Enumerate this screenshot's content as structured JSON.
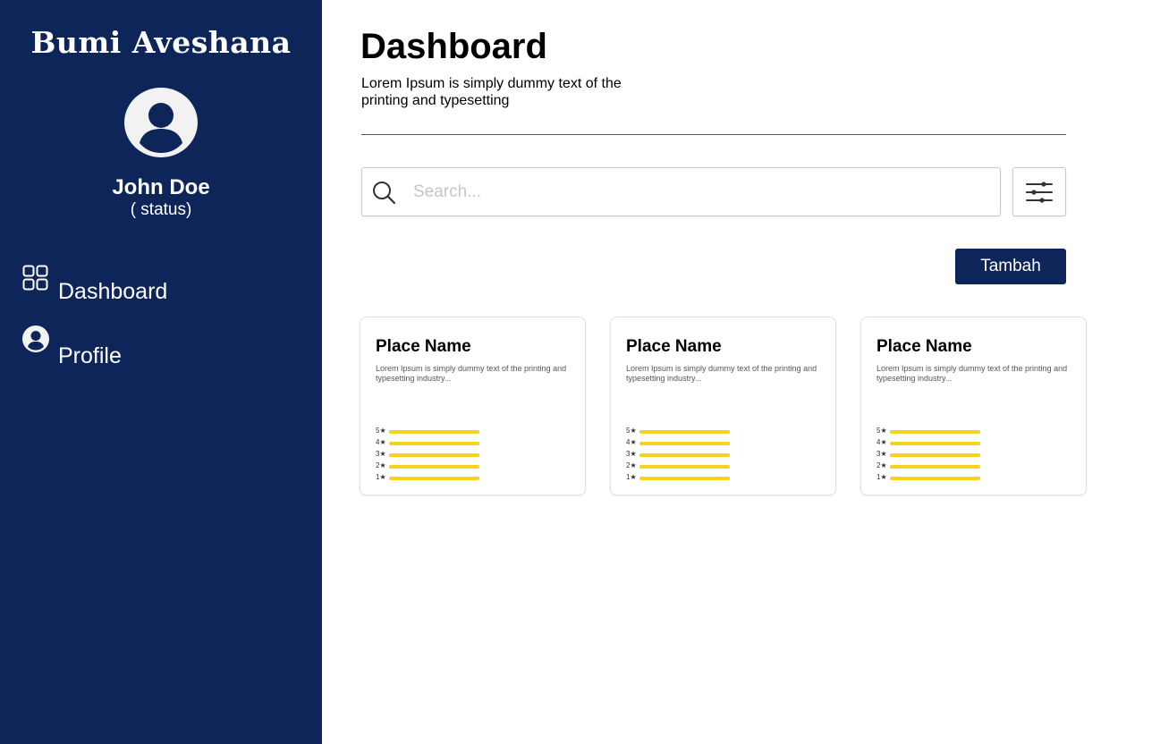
{
  "sidebar": {
    "brand": "Bumi Aveshana",
    "user": {
      "name": "John Doe",
      "status": "( status)"
    },
    "nav": [
      {
        "label": "Dashboard",
        "icon": "grid-icon"
      },
      {
        "label": "Profile",
        "icon": "user-circle-icon"
      }
    ]
  },
  "header": {
    "title": "Dashboard",
    "subtitle": "Lorem Ipsum is simply dummy text of the printing and typesetting"
  },
  "search": {
    "placeholder": "Search...",
    "value": ""
  },
  "toolbar": {
    "add_label": "Tambah",
    "filter_icon": "sliders-icon"
  },
  "cards": [
    {
      "title": "Place Name",
      "description": "Lorem Ipsum is simply dummy text of the printing and typesetting industry...",
      "ratings": [
        {
          "label": "5★",
          "fill": 1.0
        },
        {
          "label": "4★",
          "fill": 1.0
        },
        {
          "label": "3★",
          "fill": 1.0
        },
        {
          "label": "2★",
          "fill": 1.0
        },
        {
          "label": "1★",
          "fill": 1.0
        }
      ]
    },
    {
      "title": "Place Name",
      "description": "Lorem Ipsum is simply dummy text of the printing and typesetting industry...",
      "ratings": [
        {
          "label": "5★",
          "fill": 1.0
        },
        {
          "label": "4★",
          "fill": 1.0
        },
        {
          "label": "3★",
          "fill": 1.0
        },
        {
          "label": "2★",
          "fill": 1.0
        },
        {
          "label": "1★",
          "fill": 1.0
        }
      ]
    },
    {
      "title": "Place Name",
      "description": "Lorem Ipsum is simply dummy text of the printing and typesetting industry...",
      "ratings": [
        {
          "label": "5★",
          "fill": 1.0
        },
        {
          "label": "4★",
          "fill": 1.0
        },
        {
          "label": "3★",
          "fill": 1.0
        },
        {
          "label": "2★",
          "fill": 1.0
        },
        {
          "label": "1★",
          "fill": 1.0
        }
      ]
    }
  ],
  "colors": {
    "sidebar_bg": "#0d2559",
    "accent": "#0d2559",
    "rating_bar": "#f7d21c"
  }
}
